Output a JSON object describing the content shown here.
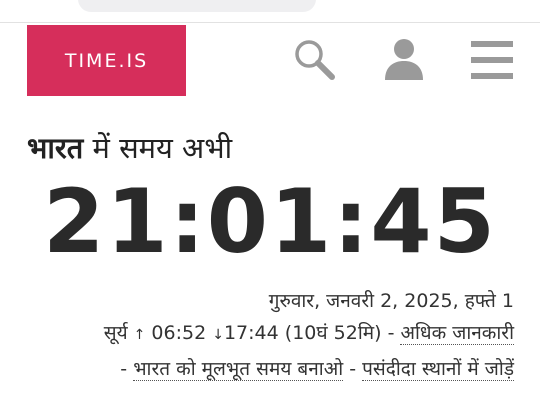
{
  "header": {
    "logo_text": "TIME.IS",
    "logo_color": "#d62e5b",
    "icons": [
      "search-icon",
      "user-icon",
      "menu-icon"
    ]
  },
  "title": {
    "bold_part": "भारत",
    "rest": " में समय अभी"
  },
  "clock": {
    "time": "21:01:45"
  },
  "date_line": "गुरुवार, जनवरी 2, 2025, हफ्ते 1",
  "sun": {
    "label": "सूर्य",
    "rise_arrow": "↑",
    "sunrise": "06:52",
    "set_arrow": "↓",
    "sunset": "17:44",
    "day_length": "(10घं 52मि)",
    "separator": "-",
    "more_info_link": "अधिक जानकारी"
  },
  "links": {
    "separator1": "-",
    "make_base_link": "भारत को मूलभूत समय बनाओ",
    "separator2": "-",
    "add_favorites_link": "पसंदीदा स्थानों में जोड़ें"
  }
}
